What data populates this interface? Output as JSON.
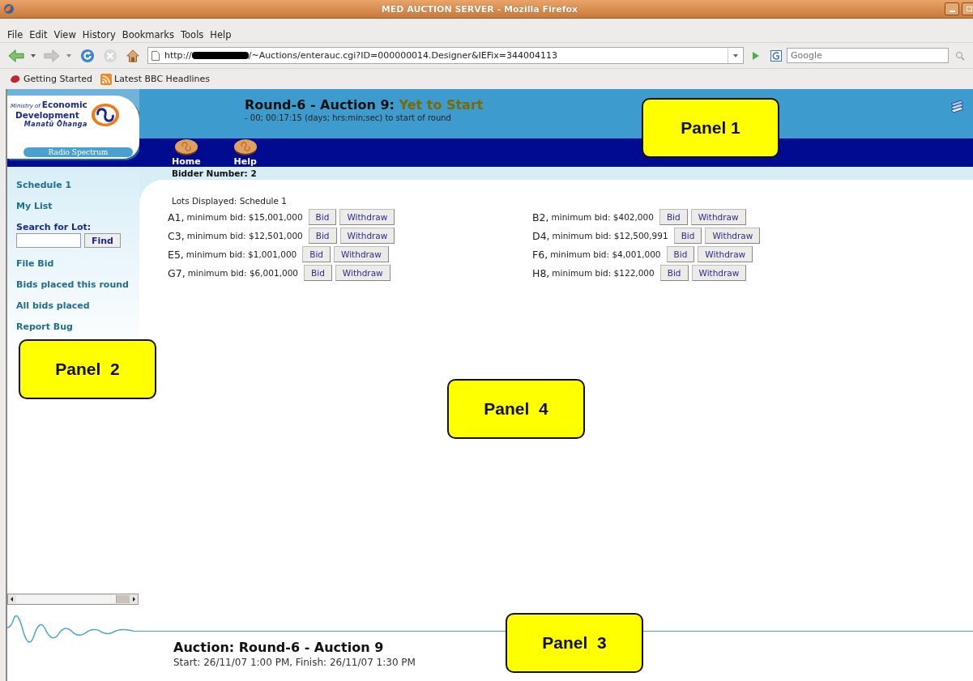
{
  "window": {
    "title": "MED AUCTION SERVER - Mozilla Firefox"
  },
  "menu": [
    "File",
    "Edit",
    "View",
    "History",
    "Bookmarks",
    "Tools",
    "Help"
  ],
  "address_bar": {
    "url_start": "http://",
    "url_end": "/~Auctions/enterauc.cgi?ID=000000014.Designer&IEFix=344004113"
  },
  "search": {
    "placeholder": "Google"
  },
  "bookmarks": [
    {
      "label": "Getting Started",
      "kind": "page"
    },
    {
      "label": "Latest BBC Headlines",
      "kind": "feed"
    }
  ],
  "logo": {
    "prefix": "Ministry of",
    "line1": "Economic",
    "line2": "Development",
    "tagline": "Manatū Ōhanga",
    "banner": "Radio Spectrum"
  },
  "header": {
    "title": "Round-6 - Auction 9:",
    "status": "Yet to Start",
    "countdown": "- 00; 00:17:15 (days; hrs:min;sec) to start of round"
  },
  "nav": [
    "Home",
    "Help"
  ],
  "bidder": "Bidder Number: 2",
  "sidebar": {
    "items_top": [
      "Schedule 1",
      "My List"
    ],
    "search_label": "Search for Lot:",
    "find_button": "Find",
    "items_bottom": [
      "File Bid",
      "Bids placed this round",
      "All bids placed",
      "Report Bug"
    ]
  },
  "lots_caption": "Lots Displayed: Schedule 1",
  "lots": [
    {
      "code": "A1,",
      "text": "minimum bid: $15,001,000",
      "buttons": [
        "Bid",
        "Withdraw"
      ]
    },
    {
      "code": "B2,",
      "text": "minimum bid: $402,000",
      "buttons": [
        "Bid",
        "Withdraw"
      ]
    },
    {
      "code": "C3,",
      "text": "minimum bid: $12,501,000",
      "buttons": [
        "Bid",
        "Withdraw"
      ]
    },
    {
      "code": "D4,",
      "text": "minimum bid: $12,500,991",
      "buttons": [
        "Bid",
        "Withdraw"
      ]
    },
    {
      "code": "E5,",
      "text": "minimum bid: $1,001,000",
      "buttons": [
        "Bid",
        "Withdraw"
      ]
    },
    {
      "code": "F6,",
      "text": "minimum bid: $4,001,000",
      "buttons": [
        "Bid",
        "Withdraw"
      ]
    },
    {
      "code": "G7,",
      "text": "minimum bid: $6,001,000",
      "buttons": [
        "Bid",
        "Withdraw"
      ]
    },
    {
      "code": "H8,",
      "text": "minimum bid: $122,000",
      "buttons": [
        "Bid",
        "Withdraw"
      ]
    }
  ],
  "footer": {
    "title": "Auction: Round-6 - Auction 9",
    "times": "Start: 26/11/07 1:00 PM, Finish: 26/11/07 1:30 PM"
  },
  "callouts": [
    "Panel 1",
    "Panel  2",
    "Panel  3",
    "Panel  4"
  ]
}
